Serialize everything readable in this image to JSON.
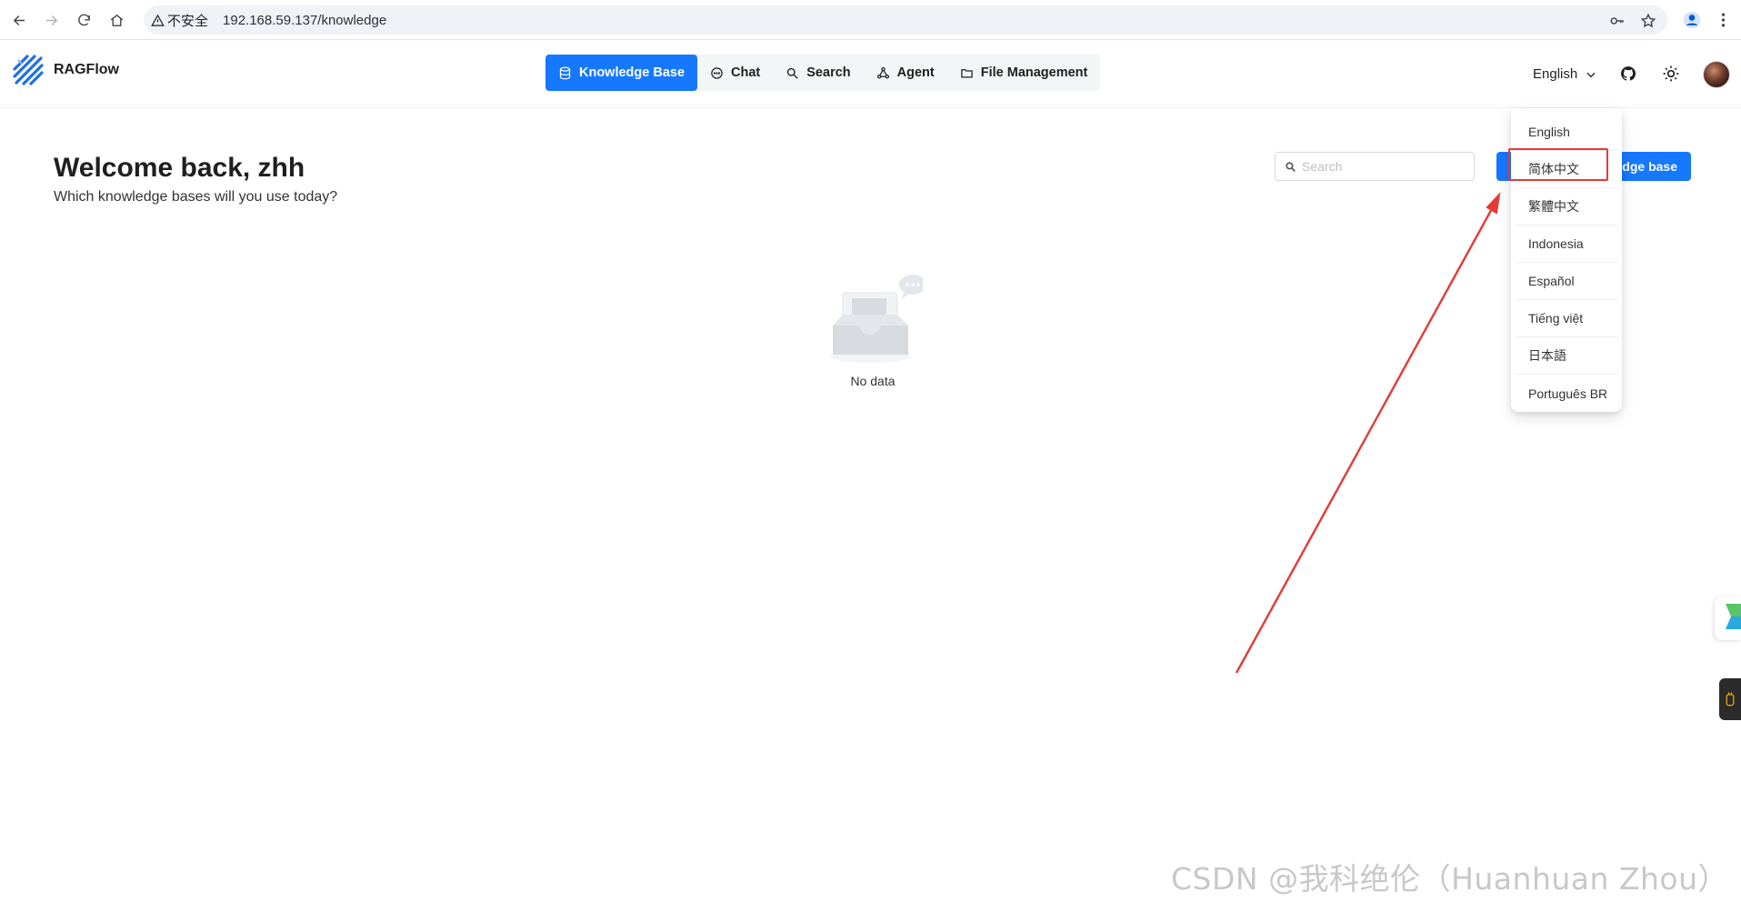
{
  "browser": {
    "security_label": "不安全",
    "url": "192.168.59.137/knowledge"
  },
  "app": {
    "brand": "RAGFlow",
    "nav_tabs": [
      {
        "label": "Knowledge Base",
        "icon": "database-icon",
        "active": true
      },
      {
        "label": "Chat",
        "icon": "chat-bubble-icon",
        "active": false
      },
      {
        "label": "Search",
        "icon": "search-icon",
        "active": false
      },
      {
        "label": "Agent",
        "icon": "agent-graph-icon",
        "active": false
      },
      {
        "label": "File Management",
        "icon": "folder-icon",
        "active": false
      }
    ],
    "language": "English"
  },
  "main": {
    "title": "Welcome back, zhh",
    "subtitle": "Which knowledge bases will you use today?",
    "search_placeholder": "Search",
    "create_button_visible_label": "dge base",
    "empty_text": "No data"
  },
  "language_menu": {
    "items": [
      "English",
      "简体中文",
      "繁體中文",
      "Indonesia",
      "Español",
      "Tiếng việt",
      "日本語",
      "Português BR"
    ],
    "highlighted": "简体中文"
  },
  "watermark": "CSDN @我科绝伦（Huanhuan Zhou）",
  "colors": {
    "primary": "#1677ff",
    "annotation_red": "#e53935"
  }
}
